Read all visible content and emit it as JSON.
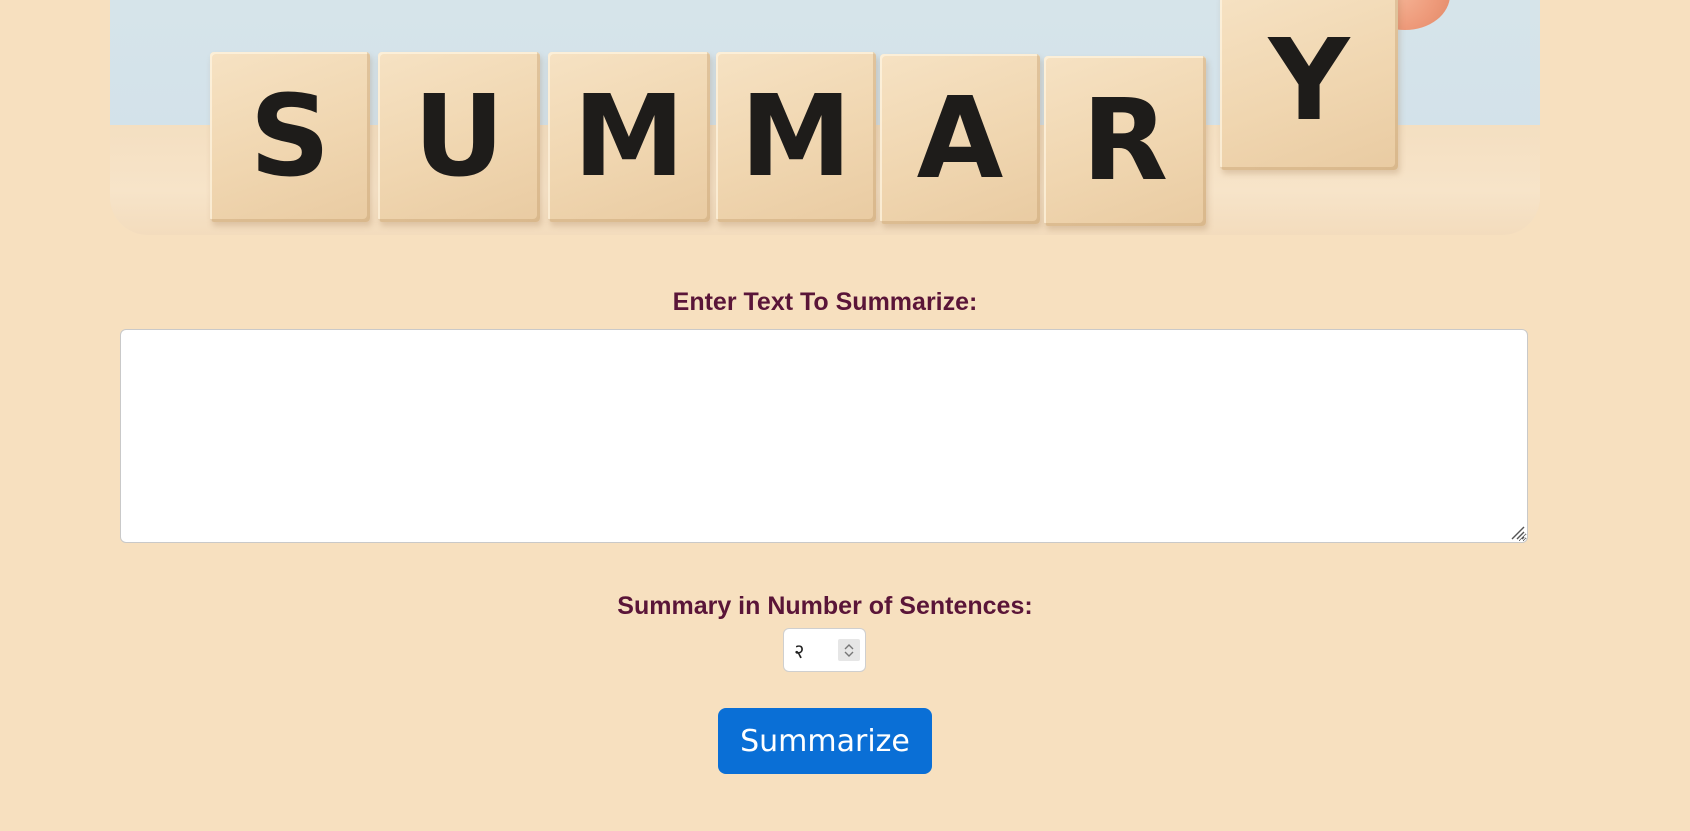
{
  "hero": {
    "letters": [
      "S",
      "U",
      "M",
      "M",
      "A",
      "R",
      "Y"
    ]
  },
  "form": {
    "text_label": "Enter Text To Summarize:",
    "text_value": "",
    "sentences_label": "Summary in Number of Sentences:",
    "sentences_value": "२",
    "submit_label": "Summarize"
  },
  "colors": {
    "page_background": "#f7e0bf",
    "label_text": "#5a1538",
    "button_background": "#0a6fd6",
    "button_text": "#ffffff"
  },
  "icons": {
    "spinner_up": "chevron-up-icon",
    "spinner_down": "chevron-down-icon",
    "resize": "resize-grip-icon"
  }
}
